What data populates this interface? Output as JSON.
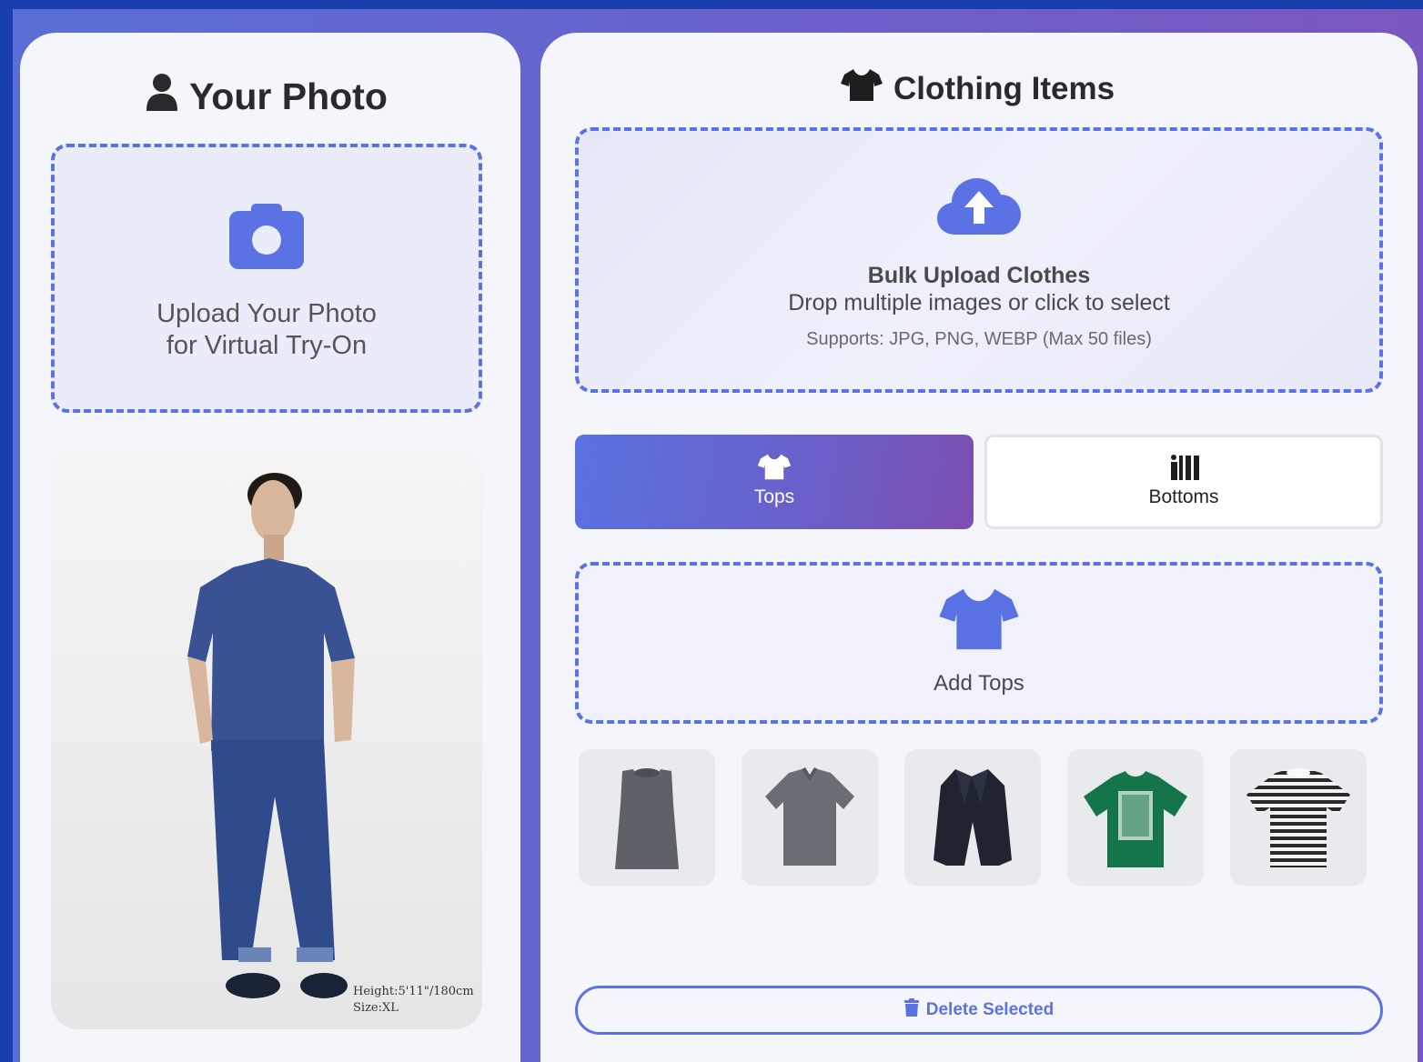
{
  "left_panel": {
    "title": "Your Photo",
    "upload_line1": "Upload Your Photo",
    "upload_line2": "for Virtual Try-On",
    "photo_caption_height": "Height:5'11\"/180cm",
    "photo_caption_size": "Size:XL"
  },
  "right_panel": {
    "title": "Clothing Items",
    "bulk_title": "Bulk Upload Clothes",
    "bulk_subtitle": "Drop multiple images or click to select",
    "bulk_note": "Supports: JPG, PNG, WEBP (Max 50 files)",
    "tabs": [
      {
        "label": "Tops",
        "icon": "tshirt-icon",
        "active": true
      },
      {
        "label": "Bottoms",
        "icon": "bottoms-icon",
        "active": false
      }
    ],
    "add_label": "Add Tops",
    "thumbnails": [
      {
        "item": "gray-sleeveless-top"
      },
      {
        "item": "gray-polo-shirt"
      },
      {
        "item": "navy-blazer"
      },
      {
        "item": "green-graphic-tee"
      },
      {
        "item": "striped-tee"
      }
    ],
    "delete_label": "Delete Selected"
  },
  "colors": {
    "accent": "#5b72e4",
    "background": "#1c3fb0",
    "panel": "#f5f6fb"
  }
}
